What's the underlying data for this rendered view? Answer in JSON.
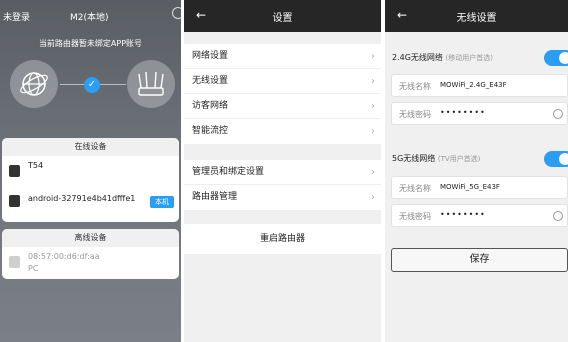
{
  "panel1": {
    "left_label": "未登录",
    "title": "M2(本地)",
    "notice": "当前路由器暂未绑定APP账号",
    "online": {
      "title": "在线设备",
      "devices": [
        {
          "name": "T54",
          "tag": ""
        },
        {
          "name": "android-32791e4b41dfffe1",
          "tag": "本机"
        }
      ]
    },
    "offline": {
      "title": "离线设备",
      "devices": [
        {
          "mac": "08:57:00:d6:df:aa",
          "type": "PC"
        }
      ]
    }
  },
  "panel2": {
    "title": "设置",
    "group1": [
      "网络设置",
      "无线设置",
      "访客网络",
      "智能流控"
    ],
    "group2": [
      "管理员和绑定设置",
      "路由器管理"
    ],
    "reboot": "重启路由器"
  },
  "panel3": {
    "title": "无线设置",
    "band24": {
      "label": "2.4G无线网络",
      "hint": "(移动用户首选)",
      "name_label": "无线名称",
      "name_value": "MOWiFi_2.4G_E43F",
      "pwd_label": "无线密码",
      "pwd_value": "••••••••",
      "enabled": true
    },
    "band5": {
      "label": "5G无线网络",
      "hint": "(TV用户首选)",
      "name_label": "无线名称",
      "name_value": "MOWiFi_5G_E43F",
      "pwd_label": "无线密码",
      "pwd_value": "••••••••",
      "enabled": true
    },
    "save": "保存"
  }
}
